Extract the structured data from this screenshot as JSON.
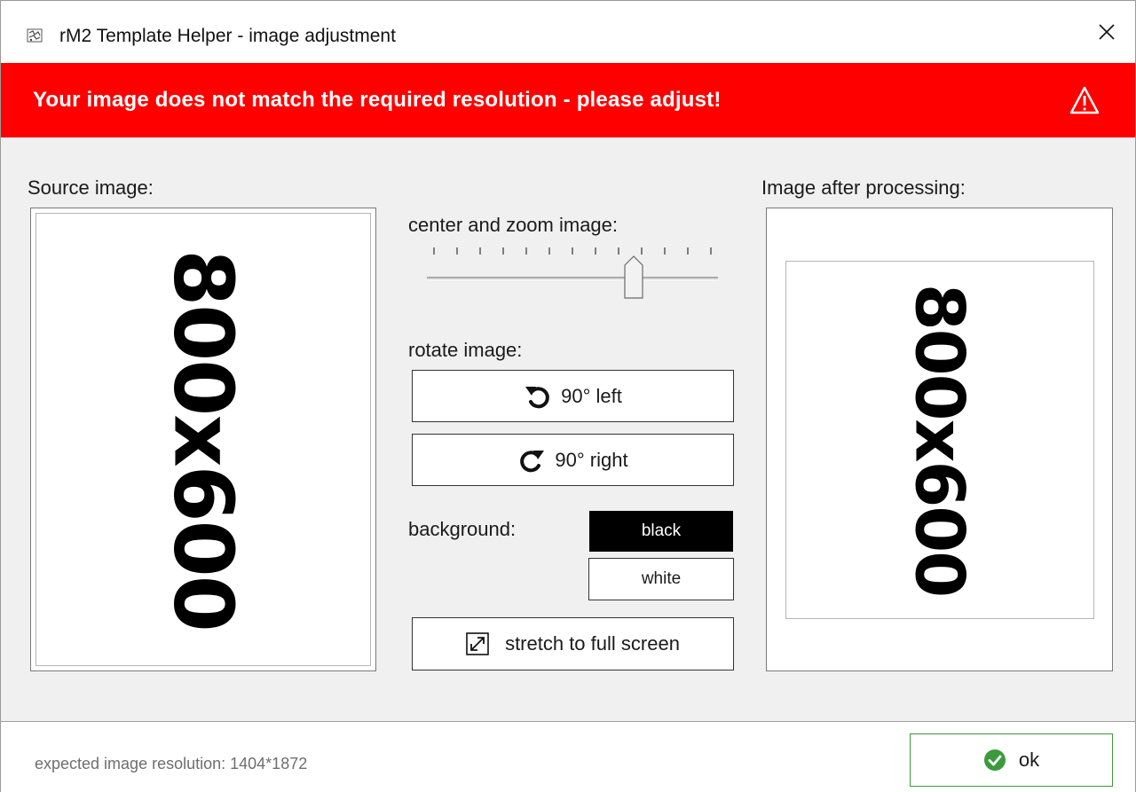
{
  "window": {
    "title": "rM2 Template Helper - image adjustment",
    "close_icon": "close-icon"
  },
  "banner": {
    "message": "Your image does not match the required resolution - please adjust!",
    "icon": "warning-triangle-icon",
    "color": "#ff0000"
  },
  "source": {
    "label": "Source image:",
    "image_text": "800x600"
  },
  "processed": {
    "label": "Image after processing:",
    "image_text": "800x600"
  },
  "zoom": {
    "label": "center and zoom image:",
    "tick_count": 13,
    "value_fraction": 0.72
  },
  "rotate": {
    "label": "rotate image:",
    "left_label": "90° left",
    "right_label": "90° right"
  },
  "background": {
    "label": "background:",
    "options": [
      "black",
      "white"
    ],
    "selected": "black"
  },
  "stretch": {
    "label": "stretch to full screen"
  },
  "footer": {
    "resolution_text": "expected image resolution: 1404*1872",
    "ok_label": "ok",
    "ok_color": "#3c9a3c"
  }
}
